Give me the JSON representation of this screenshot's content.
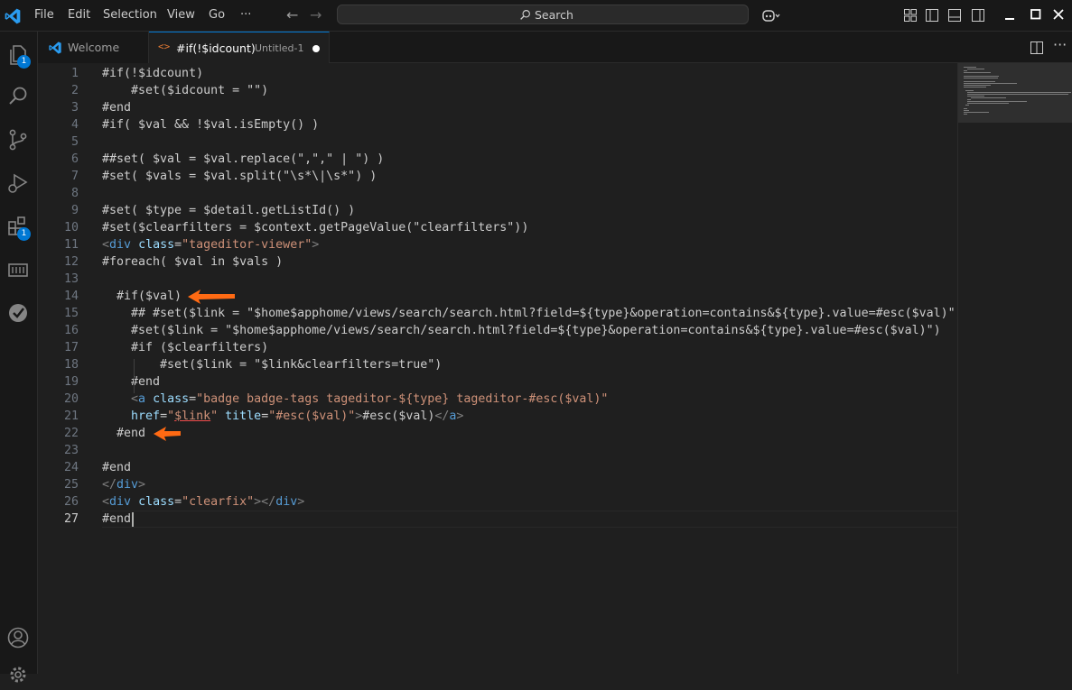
{
  "menu": [
    "File",
    "Edit",
    "Selection",
    "View",
    "Go",
    "···"
  ],
  "search": {
    "label": "Search"
  },
  "activity_badges": {
    "explorer": "1",
    "extensions": "1"
  },
  "tabs": [
    {
      "label": "Welcome",
      "icon": "vscode-logo-icon"
    },
    {
      "label": "#if(!$idcount)",
      "description": "Untitled-1",
      "icon": "code-file-icon",
      "dirty": true
    }
  ],
  "editor": {
    "cursor_line": 27,
    "lines": [
      {
        "n": "1",
        "indent": 0,
        "tokens": [
          {
            "c": "t",
            "v": "#if(!$idcount)"
          }
        ]
      },
      {
        "n": "2",
        "indent": 4,
        "tokens": [
          {
            "c": "t",
            "v": "#set($idcount = \"\")"
          }
        ]
      },
      {
        "n": "3",
        "indent": 0,
        "tokens": [
          {
            "c": "t",
            "v": "#end"
          }
        ]
      },
      {
        "n": "4",
        "indent": 0,
        "tokens": [
          {
            "c": "t",
            "v": "#if( $val && !$val.isEmpty() )"
          }
        ]
      },
      {
        "n": "5",
        "indent": 0,
        "tokens": []
      },
      {
        "n": "6",
        "indent": 0,
        "tokens": [
          {
            "c": "t",
            "v": "##set( $val = $val.replace(\",\",\" | \") )"
          }
        ]
      },
      {
        "n": "7",
        "indent": 0,
        "tokens": [
          {
            "c": "t",
            "v": "#set( $vals = $val.split(\"\\s*\\|\\s*\") )"
          }
        ]
      },
      {
        "n": "8",
        "indent": 0,
        "tokens": []
      },
      {
        "n": "9",
        "indent": 0,
        "tokens": [
          {
            "c": "t",
            "v": "#set( $type = $detail.getListId() )"
          }
        ]
      },
      {
        "n": "10",
        "indent": 0,
        "tokens": [
          {
            "c": "t",
            "v": "#set($clearfilters = $context.getPageValue(\"clearfilters\"))"
          }
        ]
      },
      {
        "n": "11",
        "indent": 0,
        "tokens": [
          {
            "c": "tg",
            "v": "<"
          },
          {
            "c": "tn",
            "v": "div"
          },
          {
            "c": "t",
            "v": " "
          },
          {
            "c": "an",
            "v": "class"
          },
          {
            "c": "t",
            "v": "="
          },
          {
            "c": "s",
            "v": "\"tageditor-viewer\""
          },
          {
            "c": "tg",
            "v": ">"
          }
        ]
      },
      {
        "n": "12",
        "indent": 0,
        "tokens": [
          {
            "c": "t",
            "v": "#foreach( $val in $vals )"
          }
        ]
      },
      {
        "n": "13",
        "indent": 0,
        "tokens": []
      },
      {
        "n": "14",
        "indent": 2,
        "tokens": [
          {
            "c": "t",
            "v": "#if($val)"
          }
        ]
      },
      {
        "n": "15",
        "indent": 4,
        "tokens": [
          {
            "c": "t",
            "v": "## #set($link = \"$home$apphome/views/search/search.html?field=${type}&operation=contains&${type}.value=#esc($val)\")"
          }
        ]
      },
      {
        "n": "16",
        "indent": 4,
        "tokens": [
          {
            "c": "t",
            "v": "#set($link = \"$home$apphome/views/search/search.html?field=${type}&operation=contains&${type}.value=#esc($val)\")"
          }
        ]
      },
      {
        "n": "17",
        "indent": 4,
        "tokens": [
          {
            "c": "t",
            "v": "#if ($clearfilters)"
          }
        ]
      },
      {
        "n": "18",
        "indent": 8,
        "tokens": [
          {
            "c": "t",
            "v": "#set($link = \"$link&clearfilters=true\")"
          }
        ]
      },
      {
        "n": "19",
        "indent": 4,
        "tokens": [
          {
            "c": "t",
            "v": "#end"
          }
        ]
      },
      {
        "n": "20",
        "indent": 4,
        "tokens": [
          {
            "c": "tg",
            "v": "<"
          },
          {
            "c": "tn",
            "v": "a"
          },
          {
            "c": "t",
            "v": " "
          },
          {
            "c": "an",
            "v": "class"
          },
          {
            "c": "t",
            "v": "="
          },
          {
            "c": "s",
            "v": "\"badge badge-tags tageditor-${type} tageditor-#esc($val)\""
          }
        ]
      },
      {
        "n": "21",
        "indent": 4,
        "tokens": [
          {
            "c": "an",
            "v": "href"
          },
          {
            "c": "t",
            "v": "="
          },
          {
            "c": "s",
            "v": "\""
          },
          {
            "c": "ul",
            "v": "$link"
          },
          {
            "c": "s",
            "v": "\""
          },
          {
            "c": "t",
            "v": " "
          },
          {
            "c": "an",
            "v": "title"
          },
          {
            "c": "t",
            "v": "="
          },
          {
            "c": "s",
            "v": "\"#esc($val)\""
          },
          {
            "c": "tg",
            "v": ">"
          },
          {
            "c": "t",
            "v": "#esc($val)"
          },
          {
            "c": "tg",
            "v": "</"
          },
          {
            "c": "tn",
            "v": "a"
          },
          {
            "c": "tg",
            "v": ">"
          }
        ]
      },
      {
        "n": "22",
        "indent": 2,
        "tokens": [
          {
            "c": "t",
            "v": "#end"
          }
        ]
      },
      {
        "n": "23",
        "indent": 0,
        "tokens": []
      },
      {
        "n": "24",
        "indent": 0,
        "tokens": [
          {
            "c": "t",
            "v": "#end"
          }
        ]
      },
      {
        "n": "25",
        "indent": 0,
        "tokens": [
          {
            "c": "tg",
            "v": "</"
          },
          {
            "c": "tn",
            "v": "div"
          },
          {
            "c": "tg",
            "v": ">"
          }
        ]
      },
      {
        "n": "26",
        "indent": 0,
        "tokens": [
          {
            "c": "tg",
            "v": "<"
          },
          {
            "c": "tn",
            "v": "div"
          },
          {
            "c": "t",
            "v": " "
          },
          {
            "c": "an",
            "v": "class"
          },
          {
            "c": "t",
            "v": "="
          },
          {
            "c": "s",
            "v": "\"clearfix\""
          },
          {
            "c": "tg",
            "v": "></"
          },
          {
            "c": "tn",
            "v": "div"
          },
          {
            "c": "tg",
            "v": ">"
          }
        ]
      },
      {
        "n": "27",
        "indent": 0,
        "tokens": [
          {
            "c": "t",
            "v": "#end"
          }
        ]
      }
    ]
  },
  "annotations": [
    {
      "target_line": "14",
      "icon": "orange-arrow-icon"
    },
    {
      "target_line": "22",
      "icon": "orange-arrow-icon"
    }
  ],
  "colors": {
    "accent": "#0078d4",
    "arrow": "#ff6a13",
    "string": "#ce9178",
    "tag": "#569cd6",
    "attribute": "#9cdcfe"
  }
}
